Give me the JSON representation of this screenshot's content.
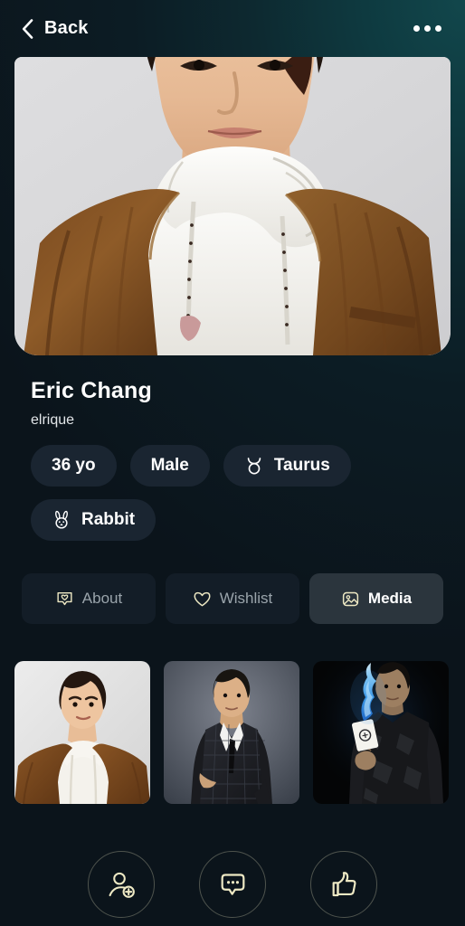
{
  "header": {
    "back_label": "Back",
    "back_icon": "chevron-left-icon",
    "more_icon": "more-horizontal-icon"
  },
  "hero": {
    "alt": "profile-photo-portrait-man-brown-velvet-jacket-white-hoodie"
  },
  "profile": {
    "name": "Eric Chang",
    "username": "elrique",
    "chips": [
      {
        "label": "36 yo",
        "icon": null
      },
      {
        "label": "Male",
        "icon": null
      },
      {
        "label": "Taurus",
        "icon": "taurus-zodiac-icon",
        "glyph": "♉"
      },
      {
        "label": "Rabbit",
        "icon": "rabbit-zodiac-icon",
        "glyph": null
      }
    ]
  },
  "tabs": [
    {
      "label": "About",
      "icon": "message-heart-icon",
      "active": false
    },
    {
      "label": "Wishlist",
      "icon": "heart-icon",
      "active": false
    },
    {
      "label": "Media",
      "icon": "image-icon",
      "active": true
    }
  ],
  "media": [
    {
      "alt": "media-thumbnail-portrait-light-background"
    },
    {
      "alt": "media-thumbnail-portrait-plaid-suit"
    },
    {
      "alt": "media-thumbnail-portrait-burning-card-blue-flame"
    }
  ],
  "actions": [
    {
      "icon": "add-user-icon"
    },
    {
      "icon": "chat-bubble-icon"
    },
    {
      "icon": "thumbs-up-icon"
    }
  ],
  "colors": {
    "accent_gold": "#eee9c4",
    "background_teal": "#0f4349",
    "background_dark": "#0b1218",
    "chip_background": "#1a2531",
    "tab_active_background": "#2b353d",
    "muted_text": "#9aa4ab"
  }
}
